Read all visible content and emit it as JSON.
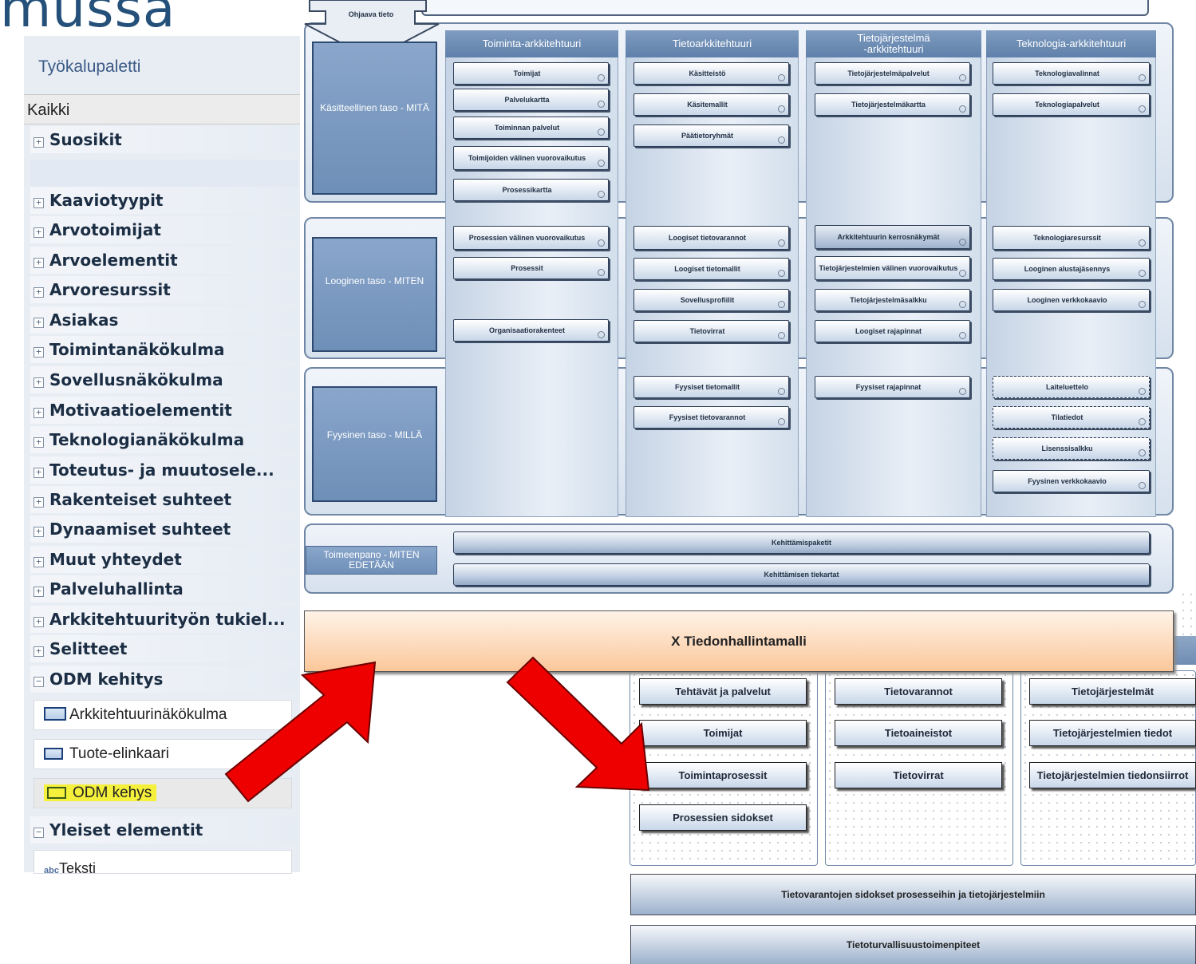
{
  "slide": {
    "title_fragment": "mussa"
  },
  "palette": {
    "title": "Työkalupaletti",
    "filter": "Kaikki",
    "categories": [
      {
        "label": "Suosikit",
        "state": "+"
      },
      {
        "label": "Kaaviotyypit",
        "state": "+"
      },
      {
        "label": "Arvotoimijat",
        "state": "+"
      },
      {
        "label": "Arvoelementit",
        "state": "+"
      },
      {
        "label": "Arvoresurssit",
        "state": "+"
      },
      {
        "label": "Asiakas",
        "state": "+"
      },
      {
        "label": "Toimintanäkökulma",
        "state": "+"
      },
      {
        "label": "Sovellusnäkökulma",
        "state": "+"
      },
      {
        "label": "Motivaatioelementit",
        "state": "+"
      },
      {
        "label": "Teknologianäkökulma",
        "state": "+"
      },
      {
        "label": "Toteutus- ja muutosele...",
        "state": "+"
      },
      {
        "label": "Rakenteiset suhteet",
        "state": "+"
      },
      {
        "label": "Dynaamiset suhteet",
        "state": "+"
      },
      {
        "label": "Muut yhteydet",
        "state": "+"
      },
      {
        "label": "Palveluhallinta",
        "state": "+"
      },
      {
        "label": "Arkkitehtuurityön tukiel...",
        "state": "+"
      },
      {
        "label": "Selitteet",
        "state": "+"
      },
      {
        "label": "ODM kehitys",
        "state": "−"
      },
      {
        "label": "Yleiset elementit",
        "state": "−"
      }
    ],
    "tools": [
      {
        "label": "Arkkitehtuurinäkökulma"
      },
      {
        "label": "Tuote-elinkaari"
      },
      {
        "label": "ODM kehys"
      },
      {
        "label": "Teksti"
      }
    ]
  },
  "diagram": {
    "ohjaava": "Ohjaava tieto",
    "columns": [
      "Toiminta-arkkitehtuuri",
      "Tietoarkkitehtuuri",
      "Tietojärjestelmä\n-arkkitehtuuri",
      "Teknologia-arkkitehtuuri"
    ],
    "rows": [
      "Käsitteellinen taso - MITÄ",
      "Looginen taso - MITEN",
      "Fyysinen taso - MILLÄ"
    ],
    "impl_row": "Toimeenpano - MITEN EDETÄÄN",
    "boxes": {
      "c1": [
        "Toimijat",
        "Palvelukartta",
        "Toiminnan palvelut",
        "Toimijoiden välinen vuorovaikutus",
        "Prosessikartta",
        "Prosessien välinen vuorovaikutus",
        "Prosessit",
        "Organisaatiorakenteet"
      ],
      "c2": [
        "Käsitteistö",
        "Käsitemallit",
        "Päätietoryhmät",
        "Loogiset tietovarannot",
        "Loogiset tietomallit",
        "Sovellusprofiilit",
        "Tietovirrat",
        "Fyysiset tietomallit",
        "Fyysiset tietovarannot"
      ],
      "c3": [
        "Tietojärjestelmäpalvelut",
        "Tietojärjestelmäkartta",
        "Arkkitehtuurin kerrosnäkymät",
        "Tietojärjestelmien välinen vuorovaikutus",
        "Tietojärjestelmäsalkku",
        "Loogiset rajapinnat",
        "Fyysiset rajapinnat"
      ],
      "c4": [
        "Teknologiavalinnat",
        "Teknologiapalvelut",
        "Teknologiaresurssit",
        "Looginen alustajäsennys",
        "Looginen verkkokaavio",
        "Laiteluettelo",
        "Tilatiedot",
        "Lisenssisalkku",
        "Fyysinen verkkokaavio"
      ]
    },
    "impl_items": [
      "Kehittämispaketit",
      "Kehittämisen tiekartat"
    ]
  },
  "banner": "X Tiedonhallintamalli",
  "model": {
    "col1": [
      "Tehtävät ja palvelut",
      "Toimijat",
      "Toimintaprosessit",
      "Prosessien sidokset"
    ],
    "col2": [
      "Tietovarannot",
      "Tietoaineistot",
      "Tietovirrat"
    ],
    "col3": [
      "Tietojärjestelmät",
      "Tietojärjestelmien tiedot",
      "Tietojärjestelmien tiedonsiirrot"
    ],
    "bars": [
      "Tietovarantojen sidokset prosesseihin ja tietojärjestelmiin",
      "Tietoturvallisuustoimenpiteet"
    ]
  },
  "colors": {
    "arrow": "#ee0000",
    "highlight": "#f5f03c",
    "banner": "#fbc79a"
  }
}
